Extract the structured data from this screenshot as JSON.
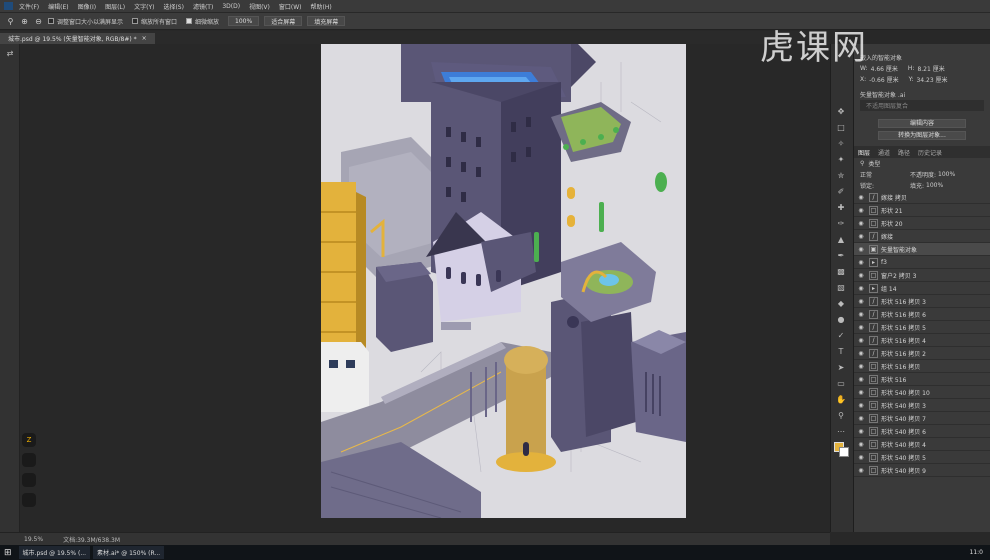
{
  "app": {
    "name": "Photoshop"
  },
  "menubar": {
    "items": [
      "文件(F)",
      "编辑(E)",
      "图像(I)",
      "图层(L)",
      "文字(Y)",
      "选择(S)",
      "滤镜(T)",
      "3D(D)",
      "视图(V)",
      "窗口(W)",
      "帮助(H)"
    ]
  },
  "options": {
    "resize_windows": "调整窗口大小以满屏显示",
    "zoom_all": "缩放所有窗口",
    "scrubby_zoom": "细微缩放",
    "zoom_100": "100%",
    "fit_screen": "适合屏幕",
    "fill_screen": "填充屏幕"
  },
  "doc_tab": {
    "title": "城市.psd @ 19.5% (矢量智能对象, RGB/8#) *"
  },
  "status": {
    "zoom": "19.5%",
    "doc_size": "文档:39.3M/638.3M"
  },
  "properties": {
    "title": "嵌入的智能对象",
    "w_label": "W:",
    "w_value": "4.66 厘米",
    "h_label": "H:",
    "h_value": "8.21 厘米",
    "x_label": "X:",
    "x_value": "-0.66 厘米",
    "y_label": "Y:",
    "y_value": "34.23 厘米",
    "source": "矢量智能对象 .ai",
    "comp": "不适用图层复合",
    "edit_btn": "编辑内容",
    "convert_btn": "转换为图层对象..."
  },
  "layers_panel": {
    "tabs": [
      "图层",
      "通道",
      "路径",
      "历史记录"
    ],
    "filter": "类型",
    "blend": "正常",
    "opacity_label": "不透明度:",
    "opacity": "100%",
    "lock_label": "锁定:",
    "fill_label": "填充:",
    "fill": "100%",
    "layers": [
      {
        "name": "嫁接 拷贝",
        "kind": "brush"
      },
      {
        "name": "形状 21",
        "kind": "shape"
      },
      {
        "name": "形状 20",
        "kind": "shape"
      },
      {
        "name": "嫁接",
        "kind": "brush"
      },
      {
        "name": "矢量智能对象",
        "kind": "smart",
        "selected": true
      },
      {
        "name": "f3",
        "kind": "group"
      },
      {
        "name": "窗户2 拷贝 3",
        "kind": "shape"
      },
      {
        "name": "组 14",
        "kind": "group"
      },
      {
        "name": "形状 516 拷贝 3",
        "kind": "brush"
      },
      {
        "name": "形状 516 拷贝 6",
        "kind": "brush"
      },
      {
        "name": "形状 516 拷贝 5",
        "kind": "brush"
      },
      {
        "name": "形状 516 拷贝 4",
        "kind": "brush"
      },
      {
        "name": "形状 516 拷贝 2",
        "kind": "brush"
      },
      {
        "name": "形状 516 拷贝",
        "kind": "shape"
      },
      {
        "name": "形状 516",
        "kind": "shape"
      },
      {
        "name": "形状 540 拷贝 10",
        "kind": "shape"
      },
      {
        "name": "形状 540 拷贝 3",
        "kind": "shape"
      },
      {
        "name": "形状 540 拷贝 7",
        "kind": "shape"
      },
      {
        "name": "形状 540 拷贝 6",
        "kind": "shape"
      },
      {
        "name": "形状 540 拷贝 4",
        "kind": "shape"
      },
      {
        "name": "形状 540 拷贝 5",
        "kind": "shape"
      },
      {
        "name": "形状 540 拷贝 9",
        "kind": "shape"
      }
    ]
  },
  "watermark": {
    "text": "虎课网"
  },
  "taskbar": {
    "items": [
      "城市.psd @ 19.5% (...",
      "素材.ai* @ 150% (R..."
    ],
    "time": "11:0"
  },
  "side_app": {
    "badge": "Z"
  },
  "colors": {
    "accent": "#f0a000",
    "bg": "#282828",
    "panel": "#3a3a3a"
  }
}
